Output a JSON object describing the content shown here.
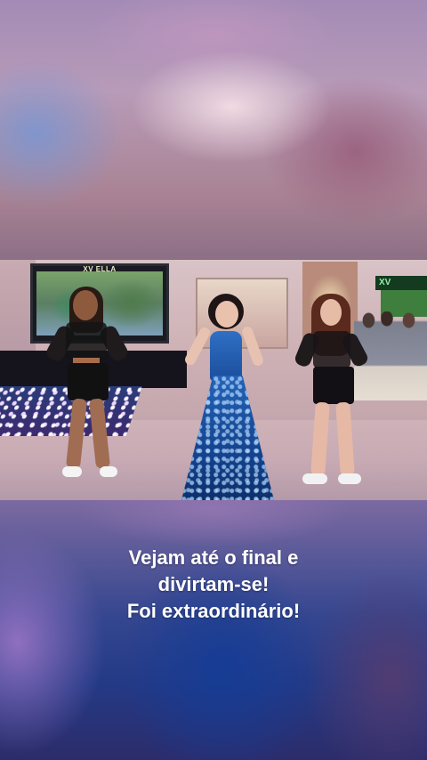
{
  "video": {
    "led_screen_text": "XV ELLA",
    "neon_sign_text": "XV"
  },
  "caption": {
    "lines": [
      "Vejam até o final e",
      "divirtam-se!",
      "Foi extraordinário!"
    ]
  }
}
